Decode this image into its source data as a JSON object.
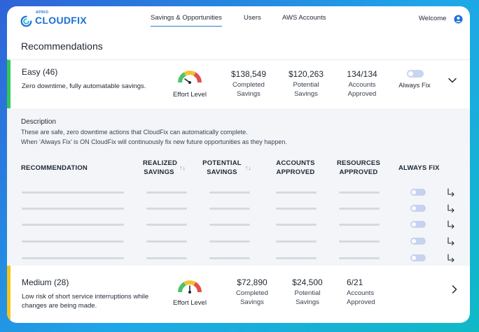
{
  "app": {
    "logo_sup": "APRIO",
    "logo_name": "CLOUDFIX"
  },
  "nav": {
    "items": [
      "Savings & Opportunities",
      "Users",
      "AWS Accounts"
    ],
    "welcome": "Welcome"
  },
  "page": {
    "title": "Recommendations"
  },
  "easy": {
    "name": "Easy (46)",
    "description": "Zero downtime, fully automatable savings.",
    "effort_label": "Effort Level",
    "completed_savings": "$138,549",
    "completed_label": "Completed Savings",
    "potential_savings": "$120,263",
    "potential_label": "Potential Savings",
    "accounts": "134/134",
    "accounts_label": "Accounts Approved",
    "always_fix_label": "Always Fix",
    "always_fix": false,
    "status_color": "#34c759"
  },
  "panel": {
    "description_title": "Description",
    "description_lines": [
      "These are safe, zero downtime actions that CloudFix can automatically complete.",
      "When ‘Always Fix’ is ON CloudFix will continuously fix new future opportunities as they happen."
    ],
    "columns": {
      "recommendation": "RECOMMENDATION",
      "realized_1": "REALIZED",
      "realized_2": "SAVINGS",
      "potential_1": "POTENTIAL",
      "potential_2": "SAVINGS",
      "accounts_1": "ACCOUNTS",
      "accounts_2": "APPROVED",
      "resources_1": "RESOURCES",
      "resources_2": "APPROVED",
      "always_fix": "ALWAYS FIX"
    },
    "sort_glyph": "↑↓"
  },
  "medium": {
    "name": "Medium (28)",
    "description": "Low risk of short service interruptions while changes are being made.",
    "effort_label": "Effort Level",
    "completed_savings": "$72,890",
    "completed_label": "Completed Savings",
    "potential_savings": "$24,500",
    "potential_label": "Potential Savings",
    "accounts": "6/21",
    "accounts_label": "Accounts Approved",
    "status_color": "#f5c518"
  },
  "colors": {
    "accent": "#2f7ad6",
    "brand": "#1a6fd6"
  }
}
